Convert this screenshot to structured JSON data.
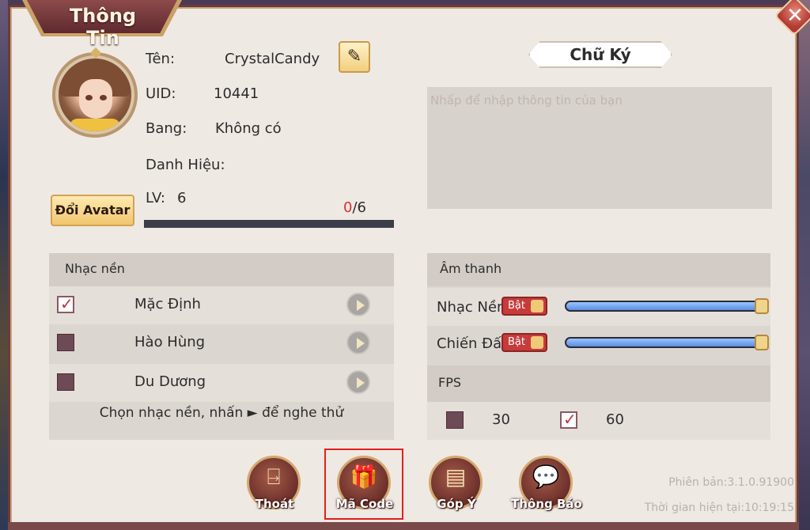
{
  "window": {
    "title": "Thông Tin",
    "close_icon": "close-icon"
  },
  "profile": {
    "name_label": "Tên:",
    "name_value": "CrystalCandy",
    "uid_label": "UID:",
    "uid_value": "10441",
    "guild_label": "Bang:",
    "guild_value": "Không có",
    "title_label": "Danh Hiệu:",
    "title_value": "",
    "level_label": "LV:",
    "level_value": "6",
    "xp_current": "0",
    "xp_max": "/6",
    "xp_fraction": 0,
    "change_avatar_label": "Đổi Avatar",
    "edit_icon": "pencil-icon"
  },
  "signature": {
    "header": "Chữ Ký",
    "placeholder": "Nhấp để nhập thông tin của bạn",
    "value": ""
  },
  "music": {
    "header": "Nhạc nền",
    "items": [
      {
        "label": "Mặc Định",
        "checked": true
      },
      {
        "label": "Hào Hùng",
        "checked": false
      },
      {
        "label": "Du Dương",
        "checked": false
      }
    ],
    "hint": "Chọn nhạc nền, nhấn ► để nghe thử"
  },
  "sound": {
    "header": "Âm thanh",
    "rows": [
      {
        "label": "Nhạc Nền",
        "toggle": "Bật",
        "level": 1.0
      },
      {
        "label": "Chiến Đấu",
        "toggle": "Bật",
        "level": 1.0
      }
    ],
    "fps_header": "FPS",
    "fps_options": [
      {
        "value": "30",
        "checked": false
      },
      {
        "value": "60",
        "checked": true
      }
    ]
  },
  "bottom_buttons": [
    {
      "label": "Thoát",
      "icon": "exit-door-icon"
    },
    {
      "label": "Mã Code",
      "icon": "gift-box-icon"
    },
    {
      "label": "Góp Ý",
      "icon": "feedback-card-icon"
    },
    {
      "label": "Thông Báo",
      "icon": "chat-bubble-icon"
    }
  ],
  "footer": {
    "version": "Phiên bản:3.1.0.91900",
    "time": "Thời gian hiện tại:10:19:15"
  },
  "colors": {
    "accent_red": "#c73b3b",
    "frame": "#6b3a3e",
    "slider": "#5a8ee0"
  }
}
